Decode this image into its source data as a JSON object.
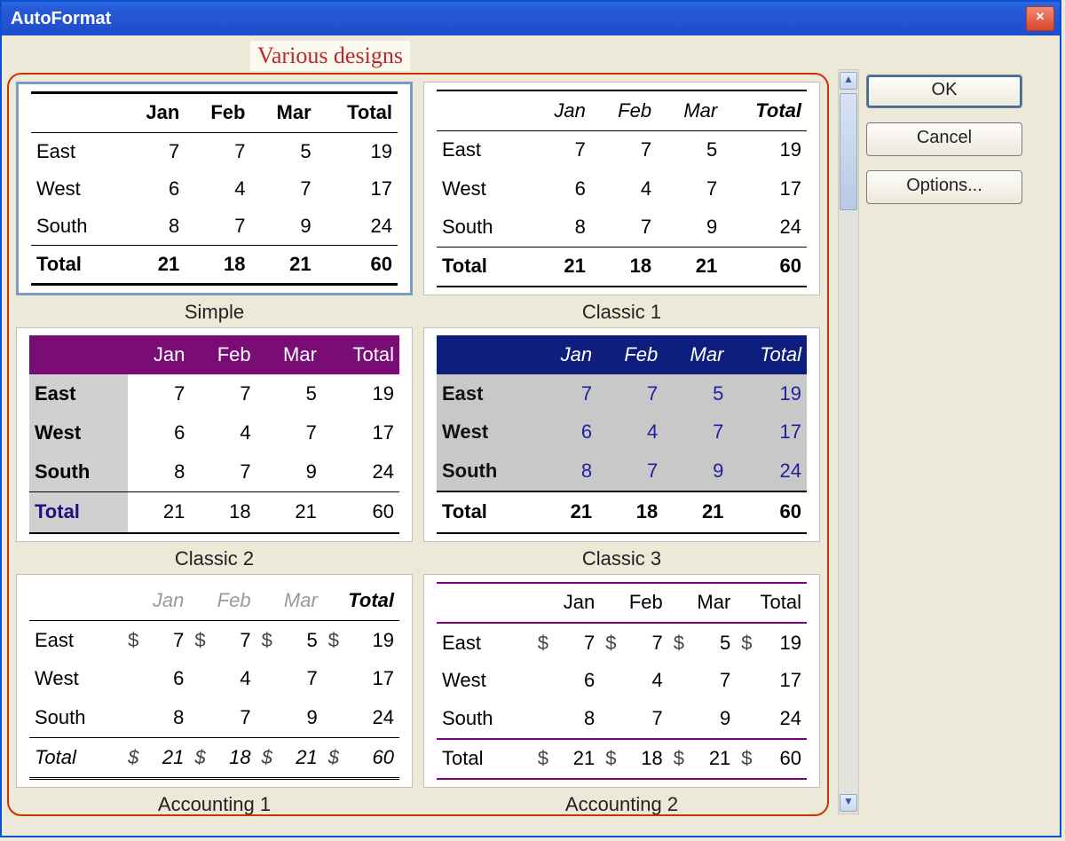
{
  "window": {
    "title": "AutoFormat"
  },
  "annotation": "Various designs",
  "buttons": {
    "ok": "OK",
    "cancel": "Cancel",
    "options": "Options..."
  },
  "table": {
    "cols": [
      "Jan",
      "Feb",
      "Mar",
      "Total"
    ],
    "rows": [
      {
        "label": "East",
        "vals": [
          7,
          7,
          5,
          19
        ]
      },
      {
        "label": "West",
        "vals": [
          6,
          4,
          7,
          17
        ]
      },
      {
        "label": "South",
        "vals": [
          8,
          7,
          9,
          24
        ]
      }
    ],
    "total": {
      "label": "Total",
      "vals": [
        21,
        18,
        21,
        60
      ]
    }
  },
  "currency": "$",
  "formats": {
    "simple": {
      "caption": "Simple"
    },
    "classic1": {
      "caption": "Classic 1"
    },
    "classic2": {
      "caption": "Classic 2"
    },
    "classic3": {
      "caption": "Classic 3"
    },
    "accounting1": {
      "caption": "Accounting 1"
    },
    "accounting2": {
      "caption": "Accounting 2"
    }
  },
  "selected": "simple"
}
